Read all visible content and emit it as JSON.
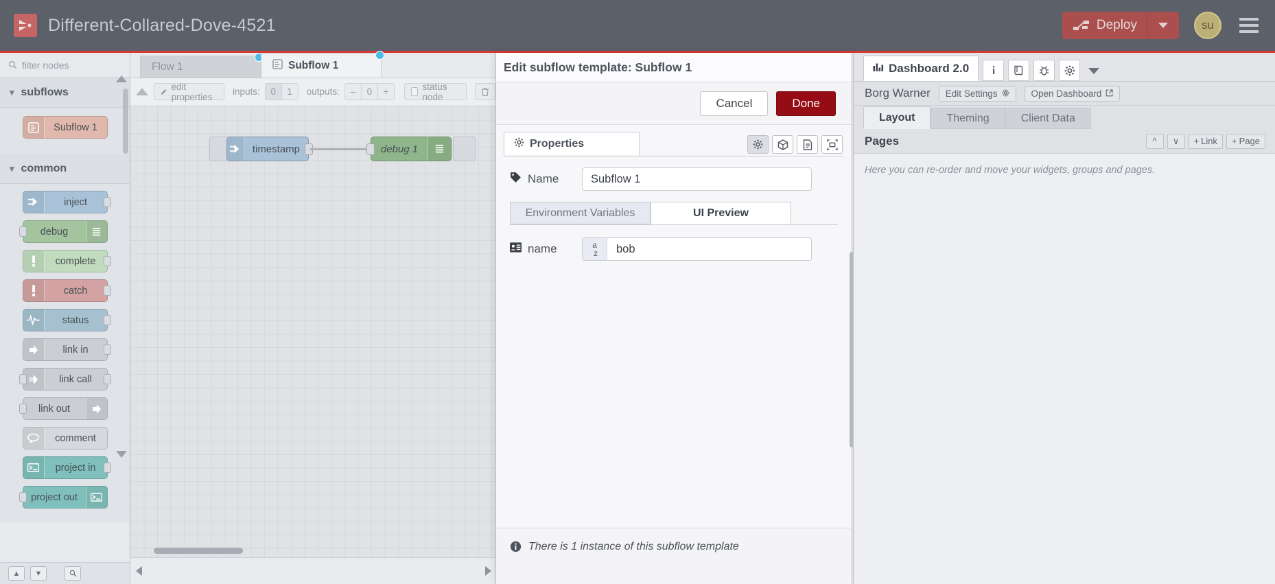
{
  "header": {
    "title": "Different-Collared-Dove-4521",
    "deploy_label": "Deploy",
    "avatar_initials": "su"
  },
  "palette": {
    "filter_placeholder": "filter nodes",
    "groups": [
      {
        "name": "subflows",
        "nodes": [
          {
            "label": "Subflow 1",
            "color": "#e0b8ac",
            "icon": "subflow-icon",
            "in": false,
            "out": false
          }
        ]
      },
      {
        "name": "common",
        "nodes": [
          {
            "label": "inject",
            "color": "#a9c2d8",
            "icon": "inject-icon",
            "in": false,
            "out": true
          },
          {
            "label": "debug",
            "color": "#a4c4a0",
            "icon": "debug-icon",
            "in": true,
            "out": false
          },
          {
            "label": "complete",
            "color": "#c0dbbd",
            "icon": "alert-icon",
            "in": false,
            "out": true
          },
          {
            "label": "catch",
            "color": "#d3a3a3",
            "icon": "alert-icon",
            "in": false,
            "out": true
          },
          {
            "label": "status",
            "color": "#a5c1cf",
            "icon": "pulse-icon",
            "in": false,
            "out": true
          },
          {
            "label": "link in",
            "color": "#cbced3",
            "icon": "link-icon",
            "in": false,
            "out": true
          },
          {
            "label": "link call",
            "color": "#cbced3",
            "icon": "linkcall-icon",
            "in": true,
            "out": true
          },
          {
            "label": "link out",
            "color": "#cbced3",
            "icon": "link-icon",
            "in": true,
            "out": false
          },
          {
            "label": "comment",
            "color": "#d5d8dc",
            "icon": "comment-icon",
            "in": false,
            "out": false
          },
          {
            "label": "project in",
            "color": "#7fc0bc",
            "icon": "project-icon",
            "in": false,
            "out": true
          },
          {
            "label": "project out",
            "color": "#7fc0bc",
            "icon": "project-icon",
            "in": true,
            "out": false
          }
        ]
      }
    ]
  },
  "editor": {
    "tabs": [
      {
        "label": "Flow 1",
        "active": false
      },
      {
        "label": "Subflow 1",
        "active": true
      }
    ],
    "toolbar": {
      "edit_properties": "edit properties",
      "inputs_label": "inputs:",
      "inputs_values": [
        "0",
        "1"
      ],
      "inputs_selected": "0",
      "outputs_label": "outputs:",
      "outputs_minus": "–",
      "outputs_value": "0",
      "outputs_plus": "+",
      "status_node": "status node"
    },
    "nodes": [
      {
        "label": "timestamp",
        "color": "#a9c2d8"
      },
      {
        "label": "debug 1",
        "color": "#a4c4a0"
      }
    ]
  },
  "dialog": {
    "title": "Edit subflow template: Subflow 1",
    "cancel_label": "Cancel",
    "done_label": "Done",
    "properties_tab": "Properties",
    "tools": [
      "gear-icon",
      "module-icon",
      "description-icon",
      "appearance-icon"
    ],
    "name_label": "Name",
    "name_value": "Subflow 1",
    "subtabs": [
      {
        "label": "Environment Variables",
        "active": false
      },
      {
        "label": "UI Preview",
        "active": true
      }
    ],
    "env": {
      "label": "name",
      "type_icon": "az-string-icon",
      "value": "bob"
    },
    "footer_note": "There is 1 instance of this subflow template"
  },
  "sidebar": {
    "main_tab": "Dashboard 2.0",
    "icons": [
      "info-icon",
      "help-icon",
      "debug-icon",
      "gear-icon"
    ],
    "dashboard_name": "Borg Warner",
    "edit_settings": "Edit Settings",
    "open_dashboard": "Open Dashboard",
    "tabs": [
      {
        "label": "Layout",
        "active": true
      },
      {
        "label": "Theming",
        "active": false
      },
      {
        "label": "Client Data",
        "active": false
      }
    ],
    "pages_title": "Pages",
    "page_buttons": [
      {
        "label": "",
        "icon": "chevron-up-icon"
      },
      {
        "label": "",
        "icon": "chevron-down-icon"
      },
      {
        "label": "Link",
        "icon": "plus-icon"
      },
      {
        "label": "Page",
        "icon": "plus-icon"
      }
    ],
    "help_text": "Here you can re-order and move your widgets, groups and pages."
  }
}
